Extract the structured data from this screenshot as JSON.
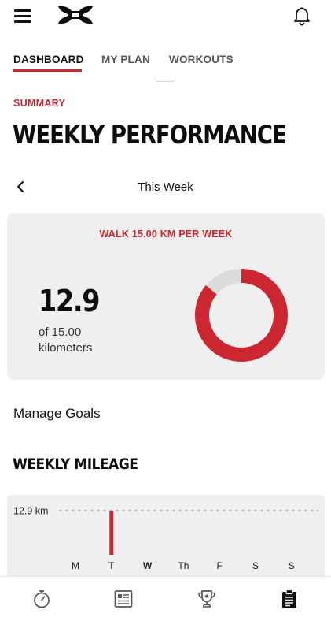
{
  "topbar": {
    "menu_icon": "hamburger-menu-icon",
    "logo_icon": "under-armour-logo",
    "notifications_icon": "bell-icon"
  },
  "tabs": [
    {
      "label": "DASHBOARD",
      "active": true
    },
    {
      "label": "MY PLAN",
      "active": false
    },
    {
      "label": "WORKOUTS",
      "active": false
    }
  ],
  "summary": {
    "kicker": "SUMMARY",
    "title": "WEEKLY PERFORMANCE"
  },
  "week_nav": {
    "label": "This Week",
    "prev_icon": "chevron-left-icon"
  },
  "goal": {
    "title": "WALK 15.00 KM PER WEEK",
    "value": "12.9",
    "of_text": "of 15.00",
    "unit": "kilometers",
    "progress": 0.86
  },
  "manage_goals_label": "Manage Goals",
  "mileage": {
    "title": "WEEKLY MILEAGE"
  },
  "chart_data": {
    "type": "bar",
    "categories": [
      "M",
      "T",
      "W",
      "Th",
      "F",
      "S",
      "S"
    ],
    "values": [
      0,
      12.9,
      0,
      0,
      0,
      0,
      0
    ],
    "reference_line": {
      "value": 12.9,
      "label": "12.9 km"
    },
    "highlighted_category_index": 2,
    "ylim": [
      0,
      12.9
    ],
    "xlabel": "",
    "ylabel": "",
    "grid": false
  },
  "bottom_nav": [
    {
      "icon": "stopwatch-icon"
    },
    {
      "icon": "activity-feed-icon"
    },
    {
      "icon": "trophy-icon"
    },
    {
      "icon": "clipboard-icon",
      "active": true
    }
  ],
  "colors": {
    "accent": "#cc2630",
    "card_bg": "#efefef",
    "ring_track": "#dcdcdc",
    "text": "#111111"
  }
}
